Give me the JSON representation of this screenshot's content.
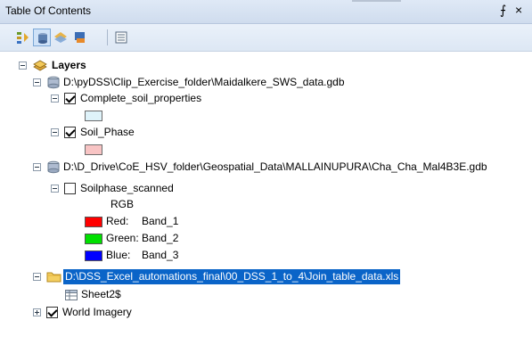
{
  "window": {
    "title": "Table Of Contents",
    "pin_glyph": "⨍",
    "close_glyph": "×"
  },
  "toolbar": {
    "buttons": [
      {
        "name": "list-by-drawing-order",
        "icon": "drawing-order-icon"
      },
      {
        "name": "list-by-source",
        "icon": "source-icon"
      },
      {
        "name": "list-by-visibility",
        "icon": "visibility-icon"
      },
      {
        "name": "list-by-selection",
        "icon": "selection-icon"
      },
      {
        "name": "options",
        "icon": "options-icon"
      }
    ]
  },
  "tree": {
    "root_label": "Layers",
    "gdb1": {
      "path": "D:\\pyDSS\\Clip_Exercise_folder\\Maidalkere_SWS_data.gdb",
      "layer1": {
        "label": "Complete_soil_properties",
        "checked": true,
        "swatch": "#dff3fa"
      },
      "layer2": {
        "label": "Soil_Phase",
        "checked": true,
        "swatch": "#f8c4c4"
      }
    },
    "gdb2": {
      "path": "D:\\D_Drive\\CoE_HSV_folder\\Geospatial_Data\\MALLAINUPURA\\Cha_Cha_Mal4B3E.gdb",
      "raster": {
        "label": "Soilphase_scanned",
        "checked": false,
        "mode": "RGB",
        "bands": [
          {
            "label": "Red:",
            "band": "Band_1",
            "color": "#ff0000"
          },
          {
            "label": "Green:",
            "band": "Band_2",
            "color": "#00e000"
          },
          {
            "label": "Blue:",
            "band": "Band_3",
            "color": "#0000ff"
          }
        ]
      }
    },
    "folder": {
      "path": "D:\\DSS_Excel_automations_final\\00_DSS_1_to_4\\Join_table_data.xls",
      "table": "Sheet2$"
    },
    "basemap": {
      "label": "World Imagery",
      "checked": true
    }
  }
}
